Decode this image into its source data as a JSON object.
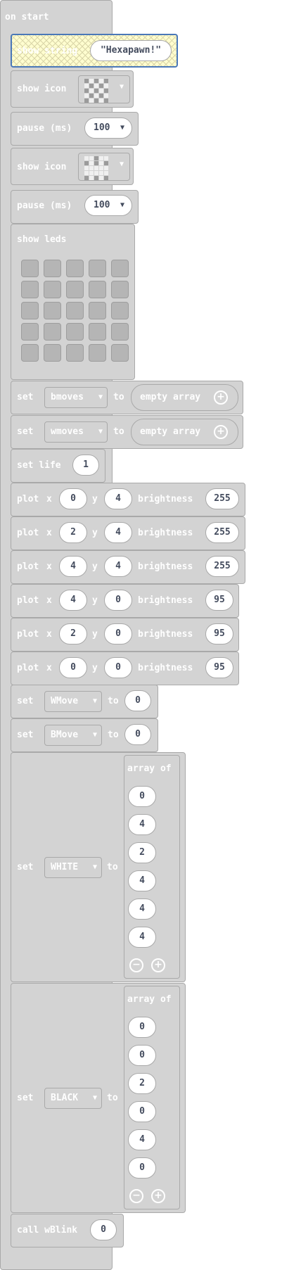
{
  "colors": {
    "block": "#d3d3d3",
    "border": "#a9a9a9",
    "text": "#ffffff",
    "value": "#444c5e",
    "highlight": "#fffdcf",
    "highlight_border": "#4a78b8"
  },
  "on_start": {
    "label": "on start"
  },
  "show_string": {
    "label": "show string",
    "value": "\"Hexapawn!\""
  },
  "show_icon_1": {
    "label": "show icon",
    "icon": "checkerboard-icon"
  },
  "pause_1": {
    "label": "pause (ms)",
    "value": "100"
  },
  "show_icon_2": {
    "label": "show icon",
    "icon": "pawn-grid-icon"
  },
  "pause_2": {
    "label": "pause (ms)",
    "value": "100"
  },
  "show_leds": {
    "label": "show leds"
  },
  "set_bmoves": {
    "set": "set",
    "var": "bmoves",
    "to": "to",
    "value": "empty array"
  },
  "set_wmoves": {
    "set": "set",
    "var": "wmoves",
    "to": "to",
    "value": "empty array"
  },
  "set_life": {
    "label": "set life",
    "value": "1"
  },
  "plots": [
    {
      "plot": "plot",
      "x_label": "x",
      "x": "0",
      "y_label": "y",
      "y": "4",
      "b_label": "brightness",
      "b": "255"
    },
    {
      "plot": "plot",
      "x_label": "x",
      "x": "2",
      "y_label": "y",
      "y": "4",
      "b_label": "brightness",
      "b": "255"
    },
    {
      "plot": "plot",
      "x_label": "x",
      "x": "4",
      "y_label": "y",
      "y": "4",
      "b_label": "brightness",
      "b": "255"
    },
    {
      "plot": "plot",
      "x_label": "x",
      "x": "4",
      "y_label": "y",
      "y": "0",
      "b_label": "brightness",
      "b": "95"
    },
    {
      "plot": "plot",
      "x_label": "x",
      "x": "2",
      "y_label": "y",
      "y": "0",
      "b_label": "brightness",
      "b": "95"
    },
    {
      "plot": "plot",
      "x_label": "x",
      "x": "0",
      "y_label": "y",
      "y": "0",
      "b_label": "brightness",
      "b": "95"
    }
  ],
  "set_wmove": {
    "set": "set",
    "var": "WMove",
    "to": "to",
    "value": "0"
  },
  "set_bmove": {
    "set": "set",
    "var": "BMove",
    "to": "to",
    "value": "0"
  },
  "set_white": {
    "set": "set",
    "var": "WHITE",
    "to": "to",
    "array_label": "array of",
    "items": [
      "0",
      "4",
      "2",
      "4",
      "4",
      "4"
    ]
  },
  "set_black": {
    "set": "set",
    "var": "BLACK",
    "to": "to",
    "array_label": "array of",
    "items": [
      "0",
      "0",
      "2",
      "0",
      "4",
      "0"
    ]
  },
  "call_wblink": {
    "label": "call wBlink",
    "value": "0"
  }
}
